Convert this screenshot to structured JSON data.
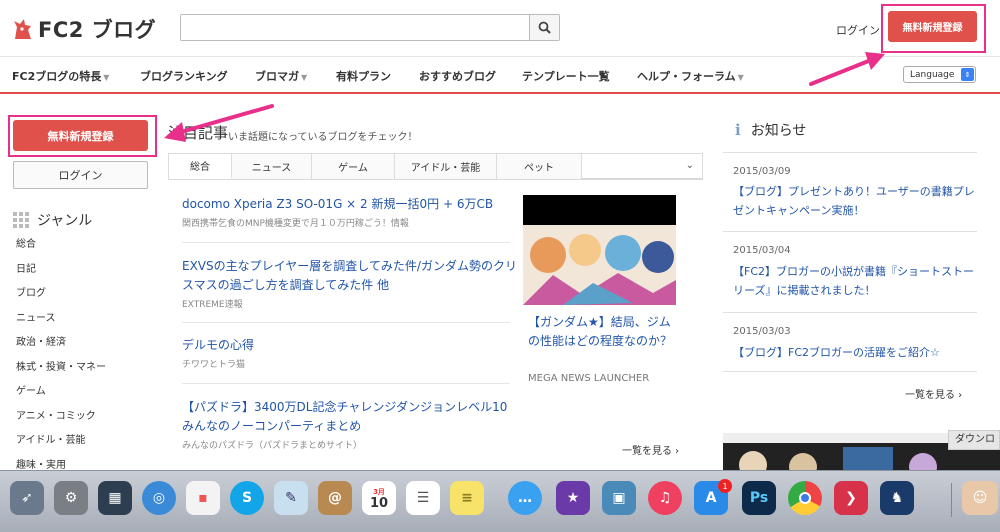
{
  "header": {
    "logo_text": "FC2 ブログ",
    "search_placeholder": "",
    "login_label": "ログイン",
    "register_label": "無料新規登録"
  },
  "nav": {
    "items": [
      {
        "label": "FC2ブログの特長",
        "has_caret": true
      },
      {
        "label": "ブログランキング",
        "has_caret": false
      },
      {
        "label": "ブロマガ",
        "has_caret": true
      },
      {
        "label": "有料プラン",
        "has_caret": false
      },
      {
        "label": "おすすめブログ",
        "has_caret": false
      },
      {
        "label": "テンプレート一覧",
        "has_caret": false
      },
      {
        "label": "ヘルプ・フォーラム",
        "has_caret": true
      }
    ],
    "language_label": "Language"
  },
  "sidebar": {
    "register_label": "無料新規登録",
    "login_label": "ログイン",
    "genre_title": "ジャンル",
    "genres": [
      "総合",
      "日記",
      "ブログ",
      "ニュース",
      "政治・経済",
      "株式・投資・マネー",
      "ゲーム",
      "アニメ・コミック",
      "アイドル・芸能",
      "趣味・実用"
    ]
  },
  "main": {
    "section_title": "注目記事",
    "section_subtitle": "いま話題になっているブログをチェック！",
    "tabs": [
      "総合",
      "ニュース",
      "ゲーム",
      "アイドル・芸能",
      "ペット"
    ],
    "articles": [
      {
        "title": "docomo Xperia Z3 SO-01G × 2 新規一括0円 + 6万CB",
        "source": "関西携帯乞食のMNP機種変更で月１０万円稼ごう！情報"
      },
      {
        "title": "EXVSの主なプレイヤー層を調査してみた件/ガンダム勢のクリスマスの過ごし方を調査してみた件 他",
        "source": "EXTREME速報"
      },
      {
        "title": "デルモの心得",
        "source": "チワワとトラ猫"
      },
      {
        "title": "【パズドラ】3400万DL記念チャレンジダンジョンレベル10みんなのノーコンパーティまとめ",
        "source": "みんなのパズドラ（パズドラまとめサイト）"
      }
    ],
    "feature": {
      "title": "【ガンダム★】結局、ジムの性能はどの程度なのか？",
      "source": "MEGA NEWS LAUNCHER"
    },
    "more_label": "一覧を見る ›"
  },
  "notices": {
    "title": "お知らせ",
    "items": [
      {
        "date": "2015/03/09",
        "text": "【ブログ】プレゼントあり！ユーザーの書籍プレゼントキャンペーン実施！"
      },
      {
        "date": "2015/03/04",
        "text": "【FC2】ブロガーの小説が書籍『ショートストーリーズ』に掲載されました！"
      },
      {
        "date": "2015/03/03",
        "text": "【ブログ】FC2ブロガーの活躍をご紹介☆"
      }
    ],
    "more_label": "一覧を見る ›",
    "download_tip": "ダウンロ"
  },
  "dock": {
    "calendar_month": "3月",
    "calendar_day": "10",
    "appstore_badge": "1",
    "photoshop_label": "Ps",
    "icons": [
      "launchpad-icon",
      "system-preferences-icon",
      "mission-control-icon",
      "safari-icon",
      "apps-grid-icon",
      "skype-icon",
      "preview-icon",
      "contacts-icon",
      "calendar-icon",
      "reminders-icon",
      "notes-icon",
      "messages-icon",
      "imovie-icon",
      "iphoto-icon",
      "music-icon",
      "app-store-icon",
      "photoshop-icon",
      "chrome-icon",
      "kindle-icon",
      "chess-icon"
    ]
  },
  "colors": {
    "accent": "#e0514b",
    "highlight": "#e8308a",
    "link": "#2255a8"
  }
}
